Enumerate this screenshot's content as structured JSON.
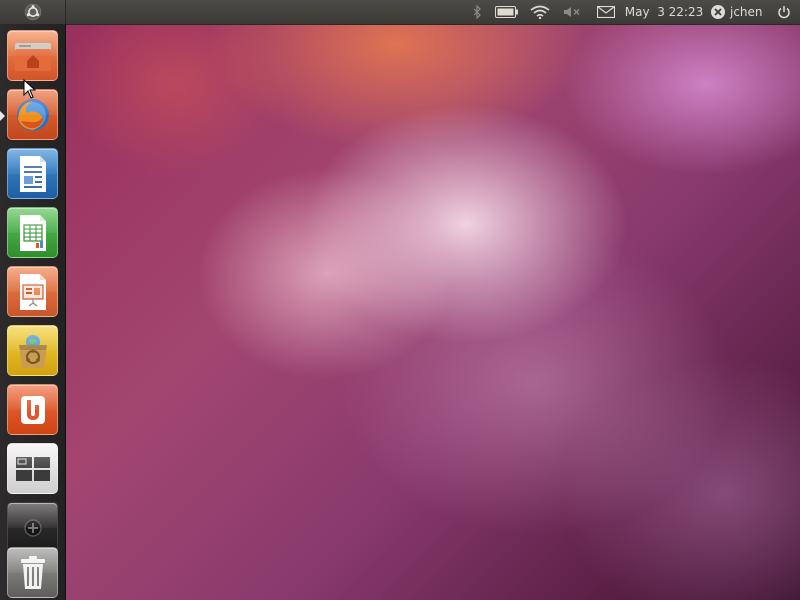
{
  "panel": {
    "bfb_icon": "ubuntu-logo-icon",
    "indicators": [
      "bluetooth-icon",
      "battery-icon",
      "wifi-icon",
      "volume-muted-icon",
      "mail-icon"
    ],
    "clock": "May  3 22:23",
    "user": "jchen",
    "session_icon": "power-icon"
  },
  "launcher": {
    "items": [
      {
        "name": "Home Folder",
        "icon": "folder-home-icon"
      },
      {
        "name": "Firefox Web Browser",
        "icon": "firefox-icon",
        "running": true
      },
      {
        "name": "LibreOffice Writer",
        "icon": "writer-icon"
      },
      {
        "name": "LibreOffice Calc",
        "icon": "calc-icon"
      },
      {
        "name": "LibreOffice Impress",
        "icon": "impress-icon"
      },
      {
        "name": "Ubuntu Software Center",
        "icon": "software-center-icon"
      },
      {
        "name": "Ubuntu One",
        "icon": "ubuntu-one-icon"
      },
      {
        "name": "Workspace Switcher",
        "icon": "workspace-switcher-icon"
      },
      {
        "name": "Applications",
        "icon": "apps-plus-icon"
      },
      {
        "name": "Trash",
        "icon": "trash-icon"
      }
    ]
  },
  "colors": {
    "panel": "#3b3a36",
    "launcher": "#2a2729",
    "wallpaper_accent": "#a24670"
  }
}
